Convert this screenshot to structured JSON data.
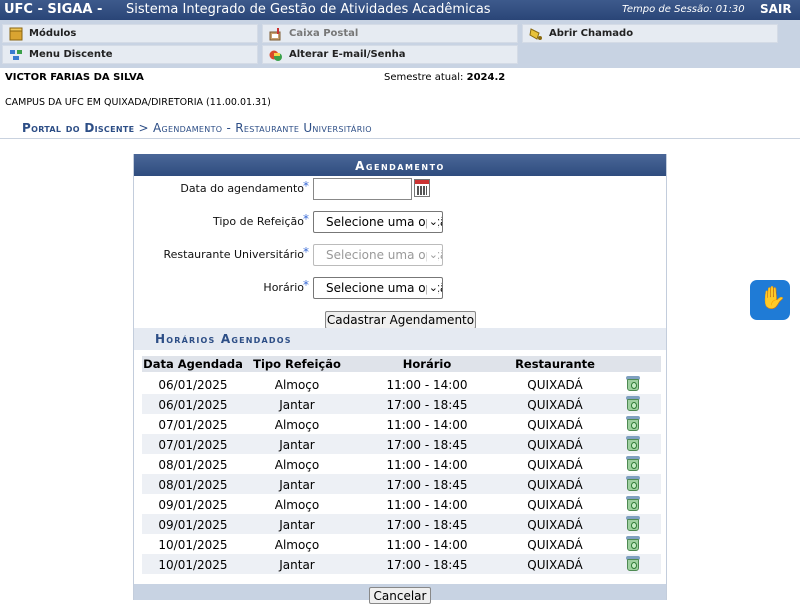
{
  "header": {
    "system": "UFC - SIGAA -",
    "system_name": "Sistema Integrado de Gestão de Atividades Acadêmicas",
    "session_label": "Tempo de Sessão: 01:30",
    "logout": "SAIR"
  },
  "menu": {
    "modulos": "Módulos",
    "caixa_postal": "Caixa Postal",
    "abrir_chamado": "Abrir Chamado",
    "menu_discente": "Menu Discente",
    "alterar_email": "Alterar E-mail/Senha"
  },
  "user": {
    "name": "VICTOR FARIAS DA SILVA",
    "semester_label": "Semestre atual:",
    "semester": "2024.2",
    "campus": "CAMPUS DA UFC EM QUIXADA/DIRETORIA (11.00.01.31)"
  },
  "breadcrumb": {
    "portal": "Portal do Discente",
    "separator": ">",
    "page": "Agendamento - Restaurante Universitário"
  },
  "form": {
    "title": "Agendamento",
    "date_label": "Data do agendamento",
    "date_value": "",
    "meal_label": "Tipo de Refeição",
    "meal_value": "Selecione uma opção",
    "restaurant_label": "Restaurante Universitário",
    "restaurant_value": "Selecione uma opção",
    "time_label": "Horário",
    "time_value": "Selecione uma opção",
    "required_mark": "*",
    "submit": "Cadastrar Agendamento"
  },
  "schedule": {
    "title": "Horários Agendados",
    "columns": [
      "Data Agendada",
      "Tipo Refeição",
      "Horário",
      "Restaurante"
    ],
    "rows": [
      {
        "date": "06/01/2025",
        "meal": "Almoço",
        "time": "11:00 - 14:00",
        "restaurant": "QUIXADÁ"
      },
      {
        "date": "06/01/2025",
        "meal": "Jantar",
        "time": "17:00 - 18:45",
        "restaurant": "QUIXADÁ"
      },
      {
        "date": "07/01/2025",
        "meal": "Almoço",
        "time": "11:00 - 14:00",
        "restaurant": "QUIXADÁ"
      },
      {
        "date": "07/01/2025",
        "meal": "Jantar",
        "time": "17:00 - 18:45",
        "restaurant": "QUIXADÁ"
      },
      {
        "date": "08/01/2025",
        "meal": "Almoço",
        "time": "11:00 - 14:00",
        "restaurant": "QUIXADÁ"
      },
      {
        "date": "08/01/2025",
        "meal": "Jantar",
        "time": "17:00 - 18:45",
        "restaurant": "QUIXADÁ"
      },
      {
        "date": "09/01/2025",
        "meal": "Almoço",
        "time": "11:00 - 14:00",
        "restaurant": "QUIXADÁ"
      },
      {
        "date": "09/01/2025",
        "meal": "Jantar",
        "time": "17:00 - 18:45",
        "restaurant": "QUIXADÁ"
      },
      {
        "date": "10/01/2025",
        "meal": "Almoço",
        "time": "11:00 - 14:00",
        "restaurant": "QUIXADÁ"
      },
      {
        "date": "10/01/2025",
        "meal": "Jantar",
        "time": "17:00 - 18:45",
        "restaurant": "QUIXADÁ"
      }
    ],
    "cancel": "Cancelar"
  },
  "colors": {
    "header_bg": "#2a4577",
    "accent": "#2d4e86",
    "required": "#3a6bd6",
    "vlibras": "#1f7bd6"
  },
  "icons": [
    "modules-icon",
    "mailbox-icon",
    "bell-icon",
    "menu-icon",
    "email-password-icon",
    "calendar-icon",
    "trash-icon",
    "sign-language-icon"
  ]
}
